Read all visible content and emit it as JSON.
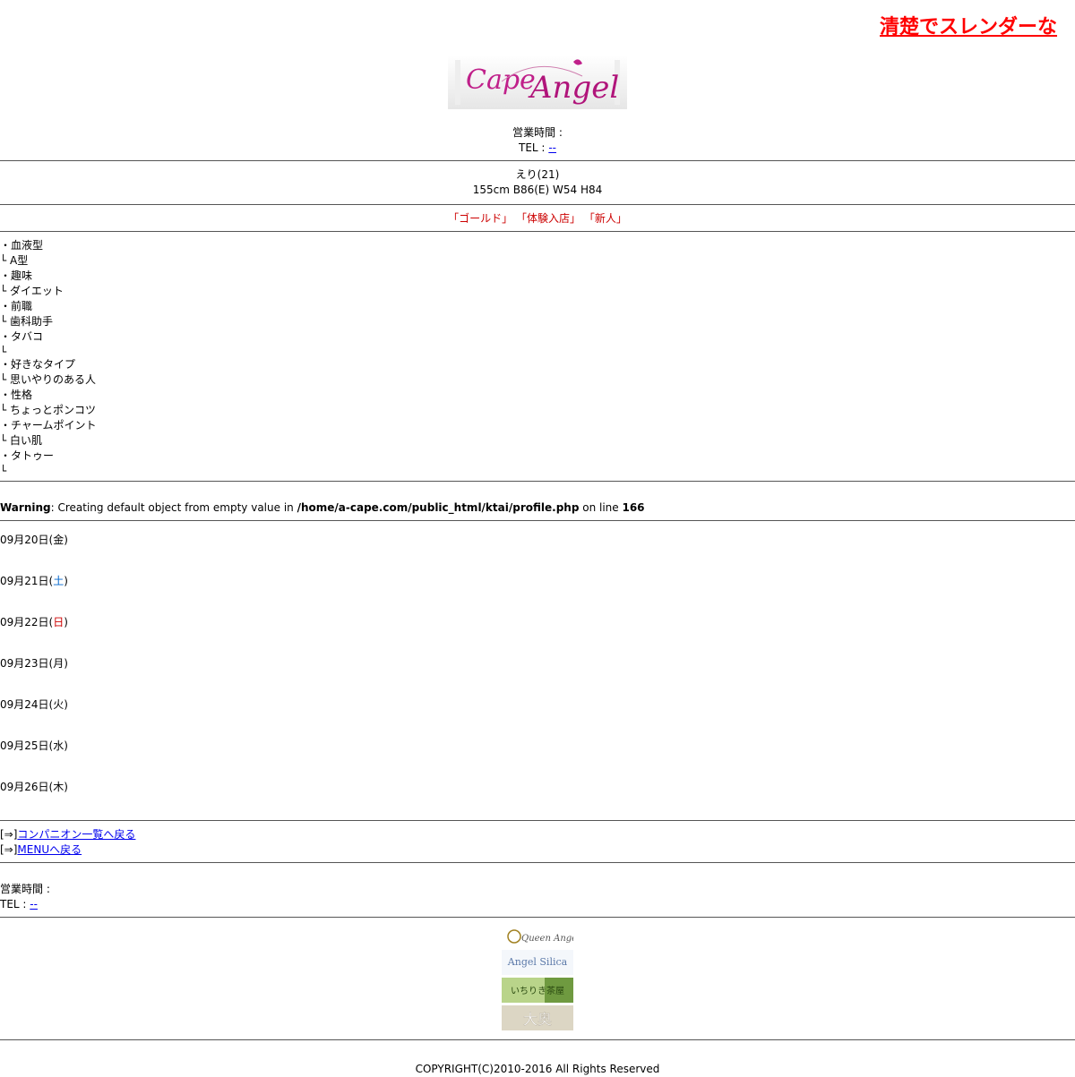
{
  "marquee": {
    "text": "清楚でスレンダーな"
  },
  "header": {
    "hours_label": "営業時間 :",
    "tel_label": "TEL :",
    "tel_link": "--"
  },
  "girl": {
    "name_age": "えり(21)",
    "measurements": "155cm B86(E) W54 H84",
    "tags": [
      "「ゴールド」",
      "「体験入店」",
      "「新人」"
    ]
  },
  "profile": [
    {
      "label": "・血液型",
      "value": "└ A型"
    },
    {
      "label": "・趣味",
      "value": "└ ダイエット"
    },
    {
      "label": "・前職",
      "value": "└ 歯科助手"
    },
    {
      "label": "・タバコ",
      "value": "└"
    },
    {
      "label": "・好きなタイプ",
      "value": "└ 思いやりのある人"
    },
    {
      "label": "・性格",
      "value": "└ ちょっとポンコツ"
    },
    {
      "label": "・チャームポイント",
      "value": "└ 白い肌"
    },
    {
      "label": "・タトゥー",
      "value": "└"
    }
  ],
  "warning": {
    "label": "Warning",
    "message": ": Creating default object from empty value in ",
    "path": "/home/a-cape.com/public_html/ktai/profile.php",
    "on_line": " on line ",
    "line": "166"
  },
  "schedule": [
    {
      "date": "09月20日(",
      "day": "金",
      "close": ")"
    },
    {
      "date": "09月21日(",
      "day": "土",
      "close": ")"
    },
    {
      "date": "09月22日(",
      "day": "日",
      "close": ")"
    },
    {
      "date": "09月23日(",
      "day": "月",
      "close": ")"
    },
    {
      "date": "09月24日(",
      "day": "火",
      "close": ")"
    },
    {
      "date": "09月25日(",
      "day": "水",
      "close": ")"
    },
    {
      "date": "09月26日(",
      "day": "木",
      "close": ")"
    }
  ],
  "nav": {
    "arrow": "[⇒]",
    "back_list": "コンパニオン一覧へ戻る",
    "back_menu": "MENUへ戻る"
  },
  "footer": {
    "hours_label": "営業時間 :",
    "tel_label": "TEL :",
    "tel_link": "--",
    "copyright": "COPYRIGHT(C)2010-2016 All Rights Reserved"
  },
  "logo": {
    "line1": "Cape",
    "line2": "Angel"
  },
  "banners": [
    {
      "label": "Queen Angel"
    },
    {
      "label": "Angel Silica"
    },
    {
      "label": "いちりき茶屋"
    },
    {
      "label": "大奥"
    }
  ],
  "colors": {
    "accent_red": "#ff0000",
    "tag_red": "#cc0000",
    "link": "#0000ee"
  }
}
